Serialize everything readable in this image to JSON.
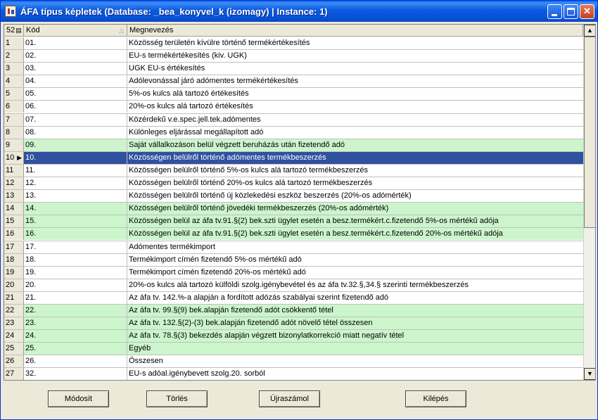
{
  "window": {
    "title": "ÁFA típus képletek    (Database: _bea_konyvel_k (izomagy)  |  Instance: 1)"
  },
  "grid": {
    "header": {
      "count": "52",
      "code": "Kód",
      "name": "Megnevezés"
    },
    "rows": [
      {
        "n": "1",
        "code": "01.",
        "name": "Közösség területén kívülre történő termékértékesítés",
        "hl": ""
      },
      {
        "n": "2",
        "code": "02.",
        "name": "EU-s termékértékesítés (kiv. UGK)",
        "hl": ""
      },
      {
        "n": "3",
        "code": "03.",
        "name": "UGK EU-s értékesítés",
        "hl": ""
      },
      {
        "n": "4",
        "code": "04.",
        "name": "Adólevonással járó adómentes termékértékesítés",
        "hl": ""
      },
      {
        "n": "5",
        "code": "05.",
        "name": "5%-os kulcs alá tartozó értékesítés",
        "hl": ""
      },
      {
        "n": "6",
        "code": "06.",
        "name": "20%-os kulcs alá tartozó értékesítés",
        "hl": ""
      },
      {
        "n": "7",
        "code": "07.",
        "name": "Közérdekű v.e.spec.jell.tek.adómentes",
        "hl": ""
      },
      {
        "n": "8",
        "code": "08.",
        "name": "Különleges eljárással megállapított adó",
        "hl": ""
      },
      {
        "n": "9",
        "code": "09.",
        "name": "Saját vállalkozáson belül végzett beruházás után fizetendő adó",
        "hl": "green"
      },
      {
        "n": "10",
        "code": "10.",
        "name": "Közösségen belülről történő adómentes termékbeszerzés",
        "hl": "selected"
      },
      {
        "n": "11",
        "code": "11.",
        "name": "Közösségen belülről történő 5%-os kulcs alá tartozó termékbeszerzés",
        "hl": ""
      },
      {
        "n": "12",
        "code": "12.",
        "name": "Közösségen belülről történő 20%-os kulcs alá tartozó termékbeszerzés",
        "hl": ""
      },
      {
        "n": "13",
        "code": "13.",
        "name": "Közösségen belülről történő új közlekedési eszköz beszerzés (20%-os adómérték)",
        "hl": ""
      },
      {
        "n": "14",
        "code": "14.",
        "name": "Közösségen belülről történő jövedéki termékbeszerzés (20%-os adómérték)",
        "hl": "green"
      },
      {
        "n": "15",
        "code": "15.",
        "name": "Közösségen belül az áfa tv.91.§(2) bek.szti ügylet esetén a besz.termékért.c.fizetendő 5%-os mértékű adója",
        "hl": "green"
      },
      {
        "n": "16",
        "code": "16.",
        "name": "Közösségen belül az áfa tv.91.§(2) bek.szti ügylet esetén a besz.termékért.c.fizetendő 20%-os mértékű adója",
        "hl": "green"
      },
      {
        "n": "17",
        "code": "17.",
        "name": "Adómentes termékimport",
        "hl": ""
      },
      {
        "n": "18",
        "code": "18.",
        "name": "Termékimport címén fizetendő 5%-os mértékű adó",
        "hl": ""
      },
      {
        "n": "19",
        "code": "19.",
        "name": "Termékimport címén fizetendő 20%-os mértékű adó",
        "hl": ""
      },
      {
        "n": "20",
        "code": "20.",
        "name": "20%-os kulcs alá tartozó külföldi szolg.igénybevétel és  az áfa tv.32.§,34.§ szerinti termékbeszerzés",
        "hl": ""
      },
      {
        "n": "21",
        "code": "21.",
        "name": "Az áfa tv. 142.%-a alapján a fordított adózás szabályai szerint fizetendő adó",
        "hl": ""
      },
      {
        "n": "22",
        "code": "22.",
        "name": "Az áfa tv. 99.§(9) bek.alapján fizetendő adót csökkentő tétel",
        "hl": "green"
      },
      {
        "n": "23",
        "code": "23.",
        "name": "Az áfa tv. 132.§(2)-(3) bek.alapján fizetendő adót növelő tétel összesen",
        "hl": "green"
      },
      {
        "n": "24",
        "code": "24.",
        "name": "Az áfa tv. 78.§(3) bekezdés alapján végzett bizonylatkorrekció miatt negatív tétel",
        "hl": "green"
      },
      {
        "n": "25",
        "code": "25.",
        "name": "Egyéb",
        "hl": "green"
      },
      {
        "n": "26",
        "code": "26.",
        "name": "Összesen",
        "hl": ""
      },
      {
        "n": "27",
        "code": "32.",
        "name": "EU-s adóal.igénybevett szolg.20. sorból",
        "hl": ""
      }
    ]
  },
  "buttons": {
    "modify": "Módosít",
    "delete": "Törlés",
    "recalc": "Újraszámol",
    "exit": "Kilépés"
  },
  "colors": {
    "highlight_green": "#ccf5cc",
    "selected": "#30519f",
    "titlebar": "#0b5ae0"
  }
}
